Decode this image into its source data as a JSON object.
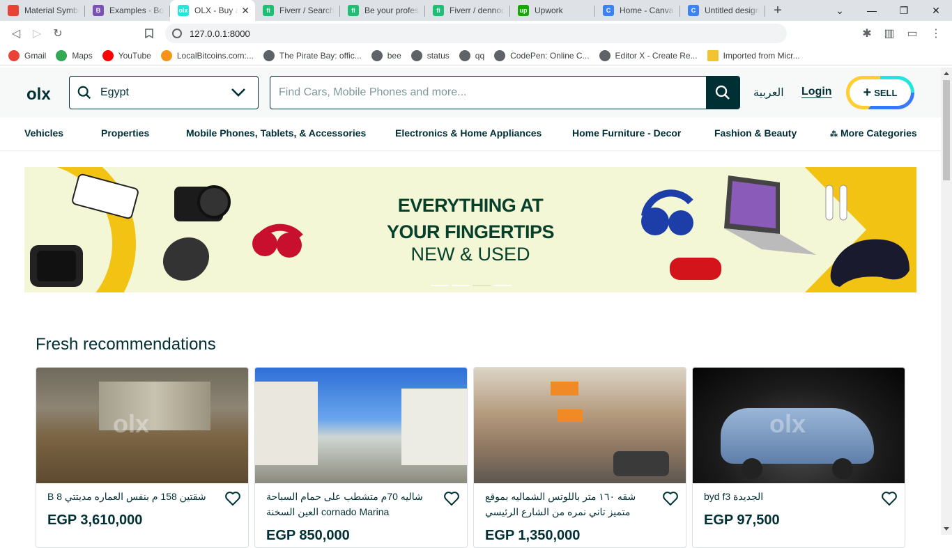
{
  "browser": {
    "tabs": [
      {
        "title": "Material Symbols",
        "fav_color": "#e94235",
        "fav_text": ""
      },
      {
        "title": "Examples · Bootstrap",
        "fav_color": "#7952b3",
        "fav_text": "B"
      },
      {
        "title": "OLX - Buy and Sell",
        "fav_color": "#23e5db",
        "fav_text": "olx",
        "active": true
      },
      {
        "title": "Fiverr / Search Results",
        "fav_color": "#1dbf73",
        "fav_text": "fi"
      },
      {
        "title": "Be your professional",
        "fav_color": "#1dbf73",
        "fav_text": "fi"
      },
      {
        "title": "Fiverr / dennodesign",
        "fav_color": "#1dbf73",
        "fav_text": "fi"
      },
      {
        "title": "Upwork",
        "fav_color": "#14a800",
        "fav_text": "up"
      },
      {
        "title": "Home - Canva",
        "fav_color": "#3b82f6",
        "fav_text": "C"
      },
      {
        "title": "Untitled design",
        "fav_color": "#3b82f6",
        "fav_text": "C"
      }
    ],
    "url": "127.0.0.1:8000",
    "bookmarks": [
      {
        "label": "Gmail",
        "color": "#ea4335"
      },
      {
        "label": "Maps",
        "color": "#34a853"
      },
      {
        "label": "YouTube",
        "color": "#ff0000"
      },
      {
        "label": "LocalBitcoins.com:...",
        "color": "#f7931a"
      },
      {
        "label": "The Pirate Bay: offic...",
        "color": "#5f6368"
      },
      {
        "label": "bee",
        "color": "#5f6368"
      },
      {
        "label": "status",
        "color": "#5f6368"
      },
      {
        "label": "qq",
        "color": "#5f6368"
      },
      {
        "label": "CodePen: Online C...",
        "color": "#5f6368"
      },
      {
        "label": "Editor X - Create Re...",
        "color": "#5f6368"
      },
      {
        "label": "Imported from Micr...",
        "color": "#f4c430"
      }
    ]
  },
  "header": {
    "logo": "olx",
    "location": "Egypt",
    "search_placeholder": "Find Cars, Mobile Phones and more...",
    "language": "العربية",
    "login": "Login",
    "sell": "SELL"
  },
  "categories": [
    "Vehicles",
    "Properties",
    "Mobile Phones, Tablets, & Accessories",
    "Electronics & Home Appliances",
    "Home Furniture - Decor",
    "Fashion & Beauty",
    "More Categories"
  ],
  "banner": {
    "line1": "EVERYTHING AT",
    "line2": "YOUR FINGERTIPS",
    "line3": "NEW & USED"
  },
  "recommendations": {
    "title": "Fresh recommendations",
    "items": [
      {
        "title": "B 8 شقتين 158 م بنفس العماره مديتتي",
        "price": "EGP 3,610,000",
        "image": "empty-room"
      },
      {
        "title": "شاليه 70م متشطب على حمام السباحة cornado Marina العين السخنة",
        "price": "EGP 850,000",
        "image": "chalets-pool"
      },
      {
        "title": "شقه ١٦٠ متر باللوتس الشماليه بموقع متميز تاني نمره من الشارع الرئيسي",
        "price": "EGP 1,350,000",
        "image": "building"
      },
      {
        "title": "byd f3 الجديدة",
        "price": "EGP 97,500",
        "image": "blue-car"
      }
    ]
  }
}
